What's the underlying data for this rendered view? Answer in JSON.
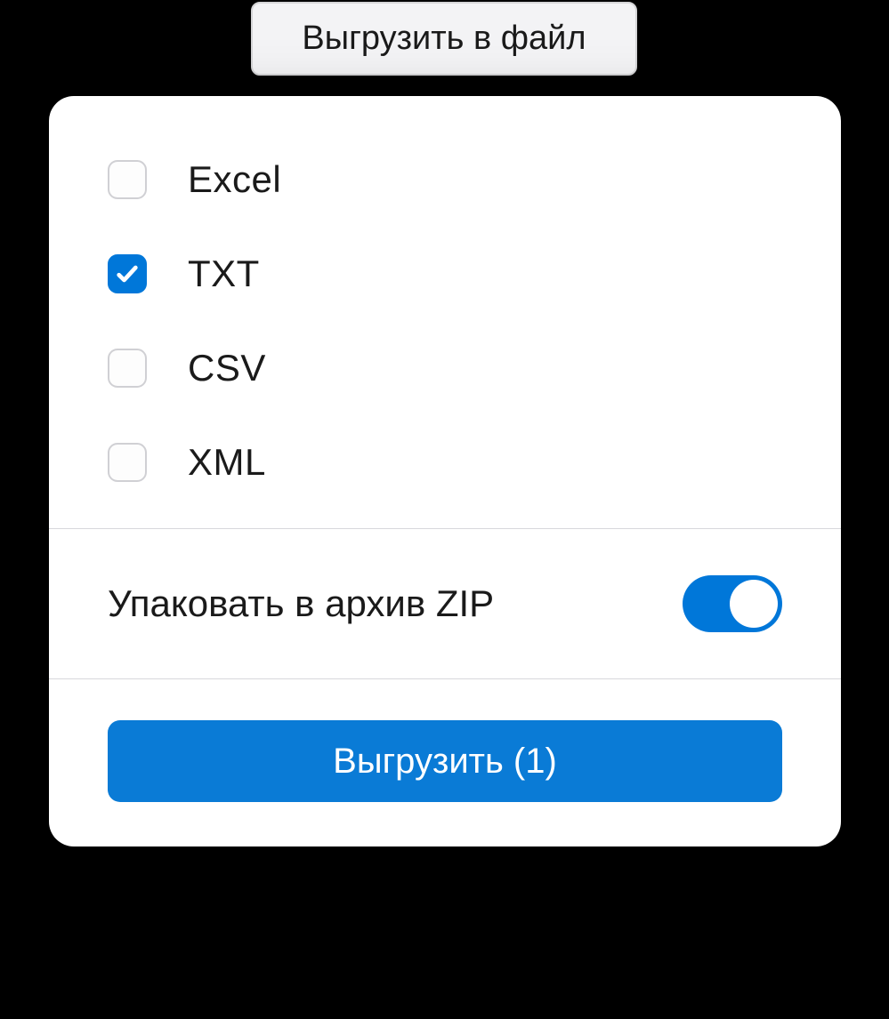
{
  "trigger": {
    "label": "Выгрузить в файл"
  },
  "formats": [
    {
      "label": "Excel",
      "checked": false
    },
    {
      "label": "TXT",
      "checked": true
    },
    {
      "label": "CSV",
      "checked": false
    },
    {
      "label": "XML",
      "checked": false
    }
  ],
  "zip": {
    "label": "Упаковать в архив ZIP",
    "enabled": true
  },
  "footer": {
    "export_label": "Выгрузить (1)"
  },
  "colors": {
    "accent": "#0077d9",
    "button": "#0a7bd6"
  }
}
